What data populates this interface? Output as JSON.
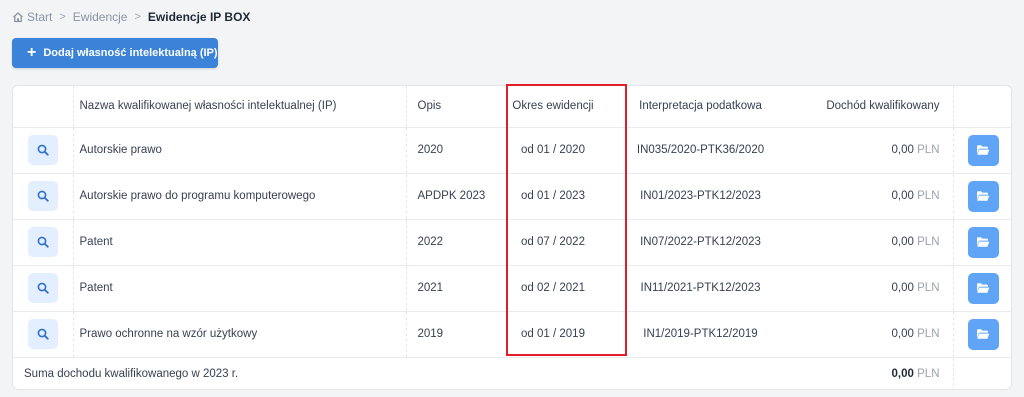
{
  "breadcrumb": {
    "items": [
      "Start",
      "Ewidencje"
    ],
    "current": "Ewidencje IP BOX"
  },
  "toolbar": {
    "add_label": "Dodaj własność intelektualną (IP)"
  },
  "table": {
    "headers": {
      "name": "Nazwa kwalifikowanej własności intelektualnej (IP)",
      "opis": "Opis",
      "okres": "Okres ewidencji",
      "interpretacja": "Interpretacja podatkowa",
      "dochod": "Dochód kwalifikowany"
    },
    "rows": [
      {
        "name": "Autorskie prawo",
        "opis": "2020",
        "okres": "od 01 / 2020",
        "interpretacja": "IN035/2020-PTK36/2020",
        "dochod": "0,00",
        "currency": "PLN"
      },
      {
        "name": "Autorskie prawo do programu komputerowego",
        "opis": "APDPK 2023",
        "okres": "od 01 / 2023",
        "interpretacja": "IN01/2023-PTK12/2023",
        "dochod": "0,00",
        "currency": "PLN"
      },
      {
        "name": "Patent",
        "opis": "2022",
        "okres": "od 07 / 2022",
        "interpretacja": "IN07/2022-PTK12/2023",
        "dochod": "0,00",
        "currency": "PLN"
      },
      {
        "name": "Patent",
        "opis": "2021",
        "okres": "od 02 / 2021",
        "interpretacja": "IN11/2021-PTK12/2023",
        "dochod": "0,00",
        "currency": "PLN"
      },
      {
        "name": "Prawo ochronne na wzór użytkowy",
        "opis": "2019",
        "okres": "od 01 / 2019",
        "interpretacja": "IN1/2019-PTK12/2019",
        "dochod": "0,00",
        "currency": "PLN"
      }
    ],
    "footer": {
      "label": "Suma dochodu kwalifikowanego w 2023 r.",
      "value": "0,00",
      "currency": "PLN"
    }
  },
  "icons": {
    "home": "home-icon",
    "separator": "chevron-right-icon",
    "add": "plus-icon",
    "view": "search-icon",
    "open": "folder-open-icon"
  },
  "colors": {
    "primary": "#3b82d9",
    "search_button_bg": "#e3efff",
    "folder_button_bg": "#60a5f5",
    "highlight": "#e01e2a"
  }
}
